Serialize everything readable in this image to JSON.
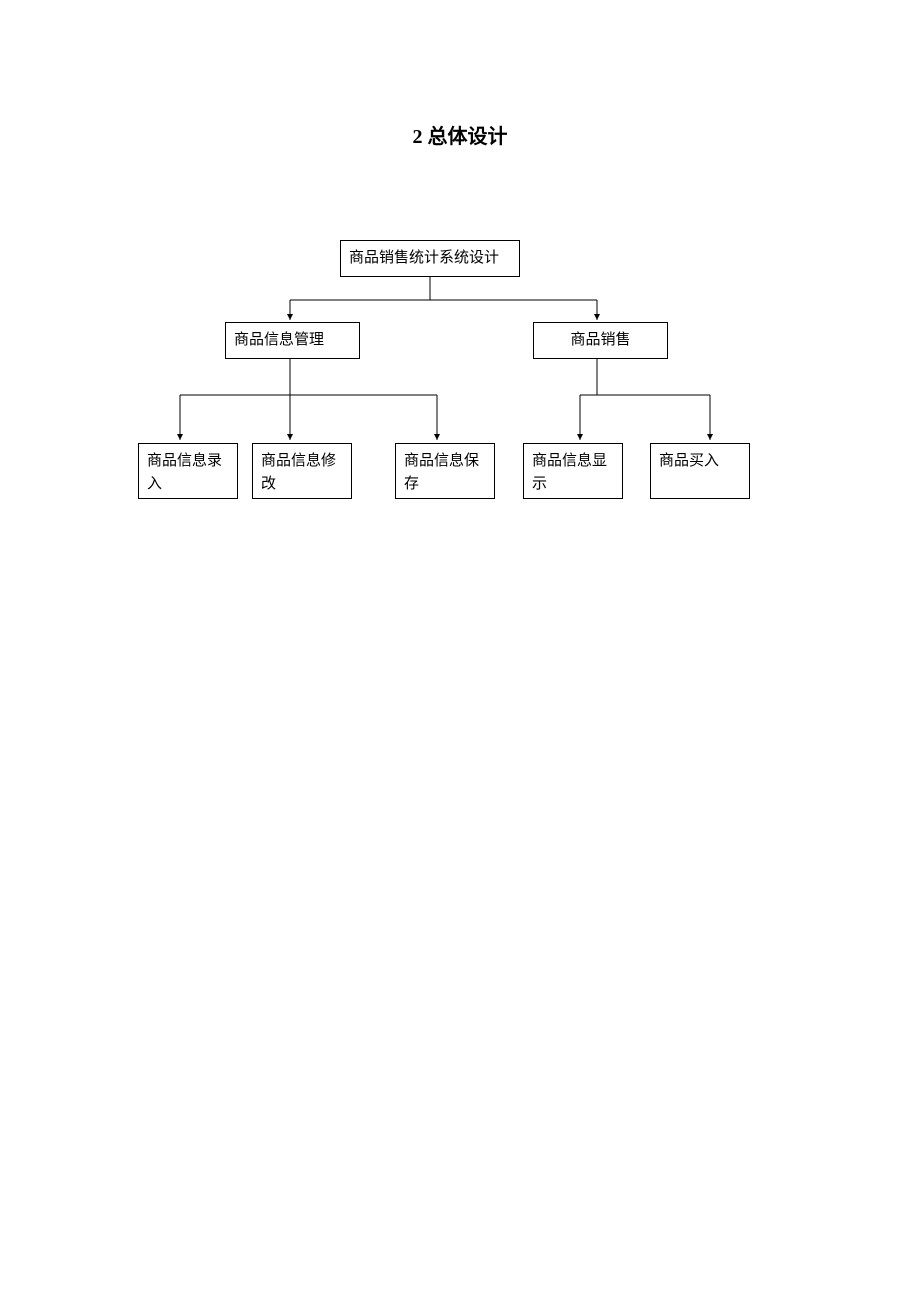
{
  "title": "2 总体设计",
  "nodes": {
    "root": "商品销售统计系统设计",
    "l2_info_mgmt": "商品信息管理",
    "l2_sales": "商品销售",
    "l3_entry": "商品信息录入",
    "l3_modify": "商品信息修改",
    "l3_save": "商品信息保存",
    "l3_display": "商品信息显示",
    "l3_buy": "商品买入"
  }
}
